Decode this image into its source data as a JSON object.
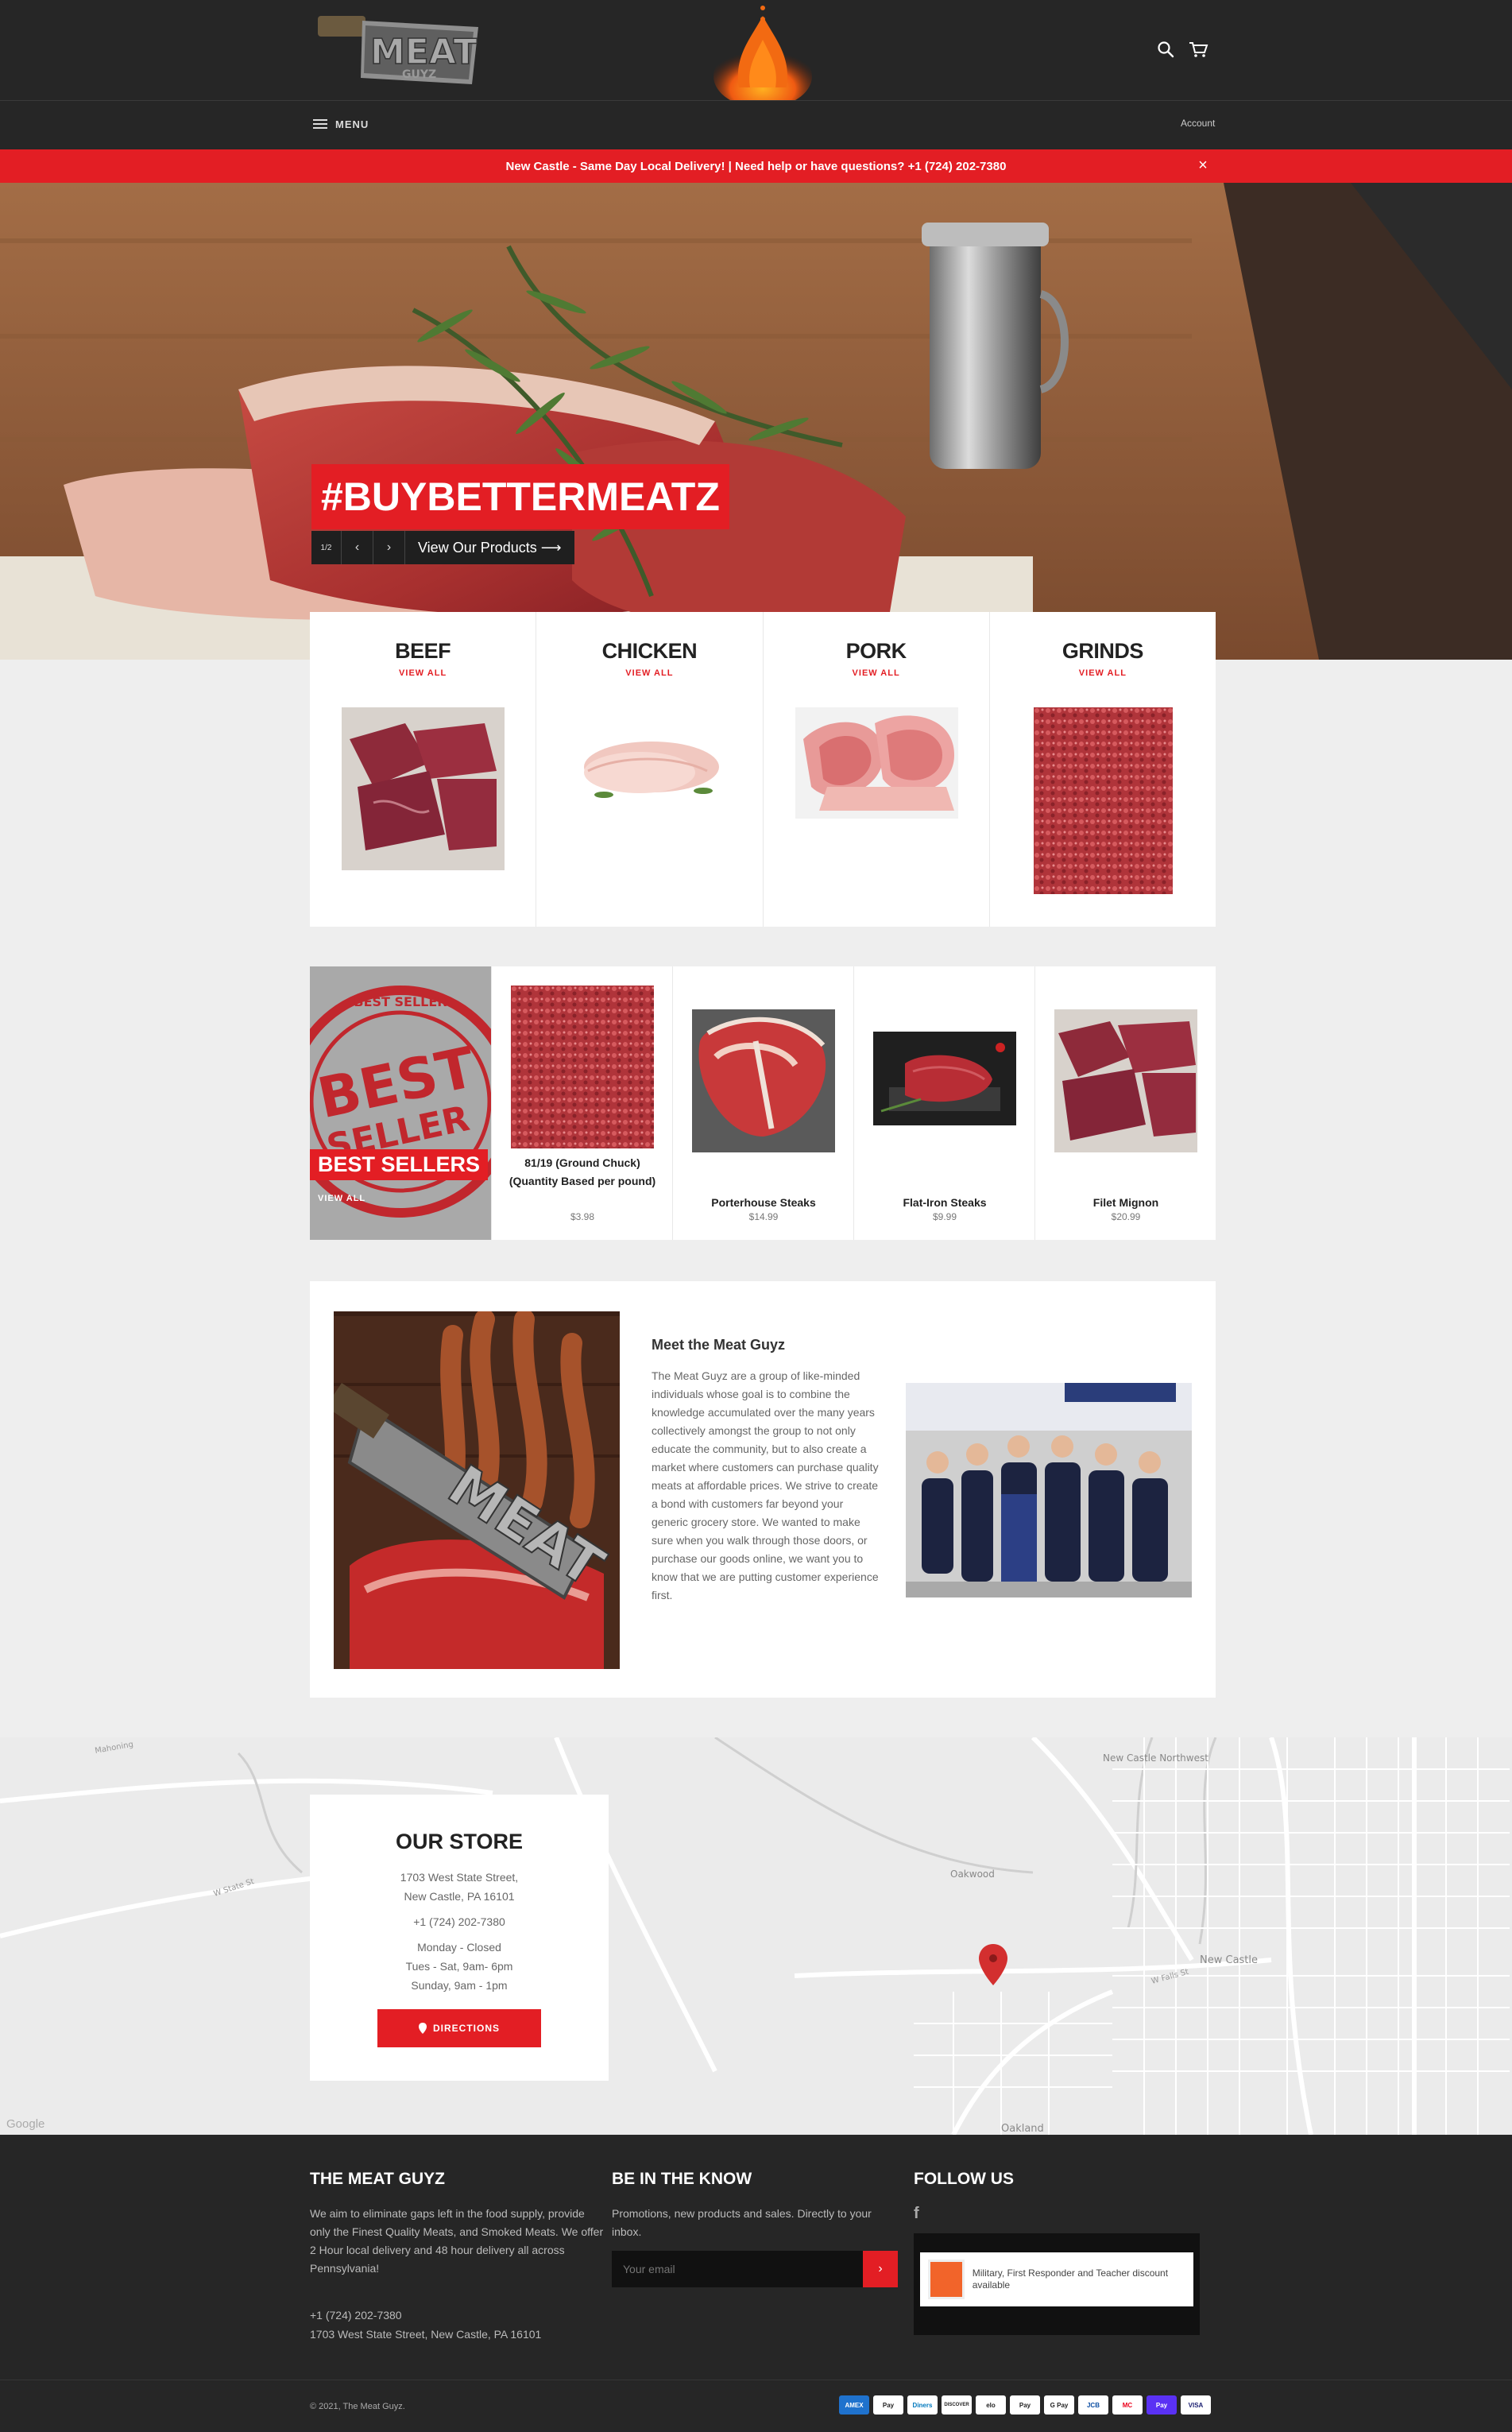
{
  "header": {
    "logo_alt": "The Meat Guyz",
    "account_label": "Account",
    "menu_label": "MENU"
  },
  "announcement": {
    "text": "New Castle - Same Day Local Delivery! | Need help or have questions? +1 (724) 202-7380",
    "close": "×"
  },
  "hero": {
    "title": "#BUYBETTERMEATZ",
    "counter": "1/2",
    "prev": "‹",
    "next": "›",
    "cta": "View Our Products ⟶"
  },
  "collections": [
    {
      "title": "BEEF",
      "link": "VIEW ALL"
    },
    {
      "title": "CHICKEN",
      "link": "VIEW ALL"
    },
    {
      "title": "PORK",
      "link": "VIEW ALL"
    },
    {
      "title": "GRINDS",
      "link": "VIEW ALL"
    }
  ],
  "bestsellers": {
    "title": "BEST SELLERS",
    "link": "VIEW ALL",
    "stamp_text": "BEST SELLER",
    "products": [
      {
        "name": "81/19 (Ground Chuck) (Quantity Based per pound)",
        "price": "$3.98"
      },
      {
        "name": "Porterhouse Steaks",
        "price": "$14.99"
      },
      {
        "name": "Flat-Iron Steaks",
        "price": "$9.99"
      },
      {
        "name": "Filet Mignon",
        "price": "$20.99"
      }
    ]
  },
  "about": {
    "title": "Meet the Meat Guyz",
    "text": "The Meat Guyz are a group of like-minded individuals whose goal is to combine the knowledge accumulated over the many years collectively amongst the group to not only educate the community, but to also create a market where customers can purchase quality meats at affordable prices. We strive to create a bond with customers far beyond your generic grocery store. We wanted to make sure when you walk through those doors, or purchase our goods online, we want you to know that we are putting customer experience first."
  },
  "map": {
    "labels": [
      "New Castle Northwest",
      "Oakwood",
      "New Castle",
      "Oakland",
      "W State St",
      "W Falls St",
      "Mahoning"
    ],
    "google": "Google"
  },
  "store": {
    "title": "OUR STORE",
    "address1": "1703 West State Street,",
    "address2": "New Castle, PA 16101",
    "phone": "+1 (724) 202-7380",
    "hours1": "Monday - Closed",
    "hours2": "Tues - Sat, 9am- 6pm",
    "hours3": "Sunday, 9am - 1pm",
    "directions": "DIRECTIONS"
  },
  "footer": {
    "col1_title": "THE MEAT GUYZ",
    "col1_text": "We aim to eliminate gaps left in the food supply, provide only the Finest Quality Meats, and Smoked Meats. We offer 2 Hour local delivery and 48 hour delivery all across Pennsylvania!",
    "phone": "+1 (724) 202-7380",
    "address": "1703 West State Street, New Castle, PA 16101",
    "col2_title": "BE IN THE KNOW",
    "col2_text": "Promotions, new products and sales. Directly to your inbox.",
    "email_placeholder": "Your email",
    "col3_title": "FOLLOW US",
    "badge_text": "Military, First Responder and Teacher discount available",
    "copyright": "© 2021, The Meat Guyz.",
    "payments": [
      "AMEX",
      "Pay",
      "Diners",
      "DISCOVER",
      "elo",
      "Pay",
      "G Pay",
      "JCB",
      "MC",
      "Pay",
      "VISA"
    ]
  },
  "colors": {
    "accent": "#e31e24",
    "header_bg": "#262626",
    "page_bg": "#eeeeee"
  }
}
